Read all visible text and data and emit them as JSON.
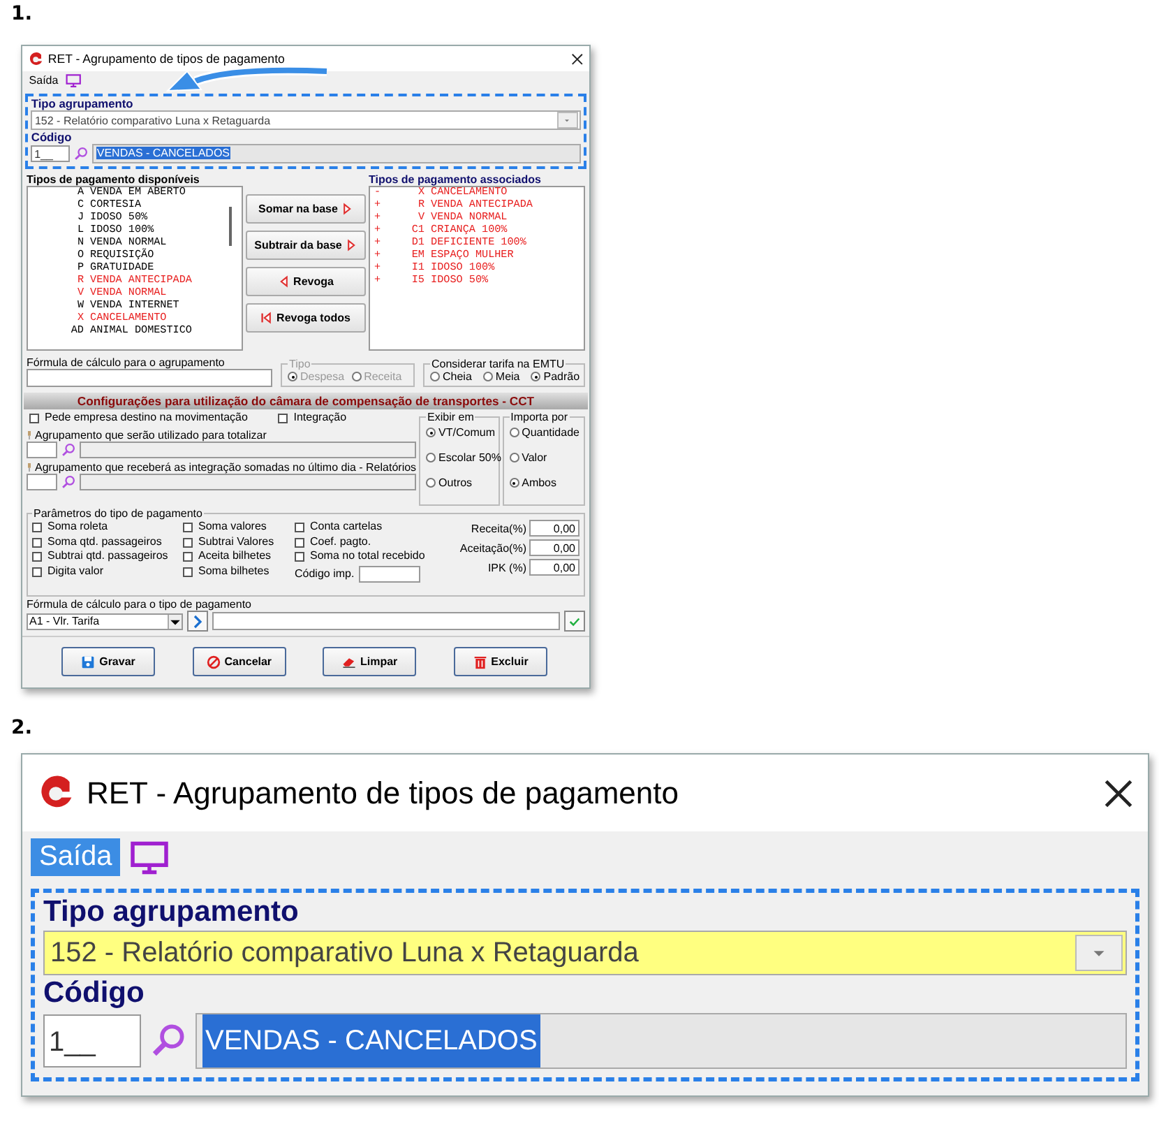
{
  "figure_1": {
    "label": "1.",
    "window": {
      "title": "RET - Agrupamento de tipos de pagamento",
      "menu": [
        {
          "label": "Saída",
          "selected": false
        }
      ],
      "tipo_agrupamento": {
        "label": "Tipo agrupamento",
        "value": "152 - Relatório comparativo Luna x Retaguarda",
        "focused": false
      },
      "codigo": {
        "label": "Código",
        "value": "1__",
        "description": "VENDAS - CANCELADOS"
      },
      "available": {
        "title": "Tipos de pagamento disponíveis",
        "items": [
          {
            "code": "A",
            "name": "VENDA EM ABERTO",
            "highlighted": false
          },
          {
            "code": "C",
            "name": "CORTESIA",
            "highlighted": false
          },
          {
            "code": "J",
            "name": "IDOSO 50%",
            "highlighted": false
          },
          {
            "code": "L",
            "name": "IDOSO 100%",
            "highlighted": false
          },
          {
            "code": "N",
            "name": "VENDA NORMAL",
            "highlighted": false
          },
          {
            "code": "O",
            "name": "REQUISIÇÃO",
            "highlighted": false
          },
          {
            "code": "P",
            "name": "GRATUIDADE",
            "highlighted": false
          },
          {
            "code": "R",
            "name": "VENDA ANTECIPADA",
            "highlighted": true
          },
          {
            "code": "V",
            "name": "VENDA NORMAL",
            "highlighted": true
          },
          {
            "code": "W",
            "name": "VENDA INTERNET",
            "highlighted": false
          },
          {
            "code": "X",
            "name": "CANCELAMENTO",
            "highlighted": true
          },
          {
            "code": "AD",
            "name": "ANIMAL DOMESTICO",
            "highlighted": false
          }
        ]
      },
      "transfer_buttons": [
        {
          "label": "Somar  na base",
          "kind": "add"
        },
        {
          "label": "Subtrair da base",
          "kind": "add"
        },
        {
          "label": "Revoga",
          "kind": "revoke"
        },
        {
          "label": "Revoga todos",
          "kind": "revoke_all"
        }
      ],
      "associated": {
        "title": "Tipos de pagamento associados",
        "items": [
          {
            "sign": "-",
            "code": "X",
            "name": "CANCELAMENTO"
          },
          {
            "sign": "+",
            "code": "R",
            "name": "VENDA ANTECIPADA"
          },
          {
            "sign": "+",
            "code": "V",
            "name": "VENDA NORMAL"
          },
          {
            "sign": "+",
            "code": "C1",
            "name": "CRIANÇA 100%"
          },
          {
            "sign": "+",
            "code": "D1",
            "name": "DEFICIENTE 100%"
          },
          {
            "sign": "+",
            "code": "EM",
            "name": "ESPAÇO MULHER"
          },
          {
            "sign": "+",
            "code": "I1",
            "name": "IDOSO 100%"
          },
          {
            "sign": "+",
            "code": "I5",
            "name": "IDOSO 50%"
          }
        ]
      },
      "formula_agrupamento": {
        "label": "Fórmula de cálculo para o agrupamento"
      },
      "tipo": {
        "label": "Tipo",
        "disabled": true,
        "options": [
          {
            "label": "Despesa",
            "selected": true
          },
          {
            "label": "Receita",
            "selected": false
          }
        ]
      },
      "tarifa": {
        "label": "Considerar tarifa na EMTU",
        "disabled": false,
        "options": [
          {
            "label": "Cheia",
            "selected": false
          },
          {
            "label": "Meia",
            "selected": false
          },
          {
            "label": "Padrão",
            "selected": true
          }
        ]
      },
      "cct_title": "Configurações para utilização do câmara de compensação de transportes - CCT",
      "cct_checks": [
        {
          "label": "Pede empresa destino na movimentação",
          "checked": false
        },
        {
          "label": "Integração",
          "checked": false
        }
      ],
      "cct_fields": [
        {
          "label": "Agrupamento que serão utilizado para totalizar"
        },
        {
          "label": "Agrupamento que receberá as integração somadas no último dia - Relatórios"
        }
      ],
      "exibir_em": {
        "label": "Exibir em",
        "options": [
          {
            "label": "VT/Comum",
            "selected": true
          },
          {
            "label": "Escolar 50%",
            "selected": false
          },
          {
            "label": "Outros",
            "selected": false
          }
        ]
      },
      "importa_por": {
        "label": "Importa por",
        "options": [
          {
            "label": "Quantidade",
            "selected": false
          },
          {
            "label": "Valor",
            "selected": false
          },
          {
            "label": "Ambos",
            "selected": true
          }
        ]
      },
      "parametros": {
        "label": "Parâmetros do tipo de pagamento",
        "columns": [
          [
            {
              "label": "Soma roleta",
              "checked": false
            },
            {
              "label": "Soma qtd. passageiros",
              "checked": false
            },
            {
              "label": "Subtrai qtd. passageiros",
              "checked": false
            },
            {
              "label": "Digita valor",
              "checked": false
            }
          ],
          [
            {
              "label": "Soma valores",
              "checked": false
            },
            {
              "label": "Subtrai Valores",
              "checked": false
            },
            {
              "label": "Aceita bilhetes",
              "checked": false
            },
            {
              "label": "Soma bilhetes",
              "checked": false
            }
          ],
          [
            {
              "label": "Conta cartelas",
              "checked": false
            },
            {
              "label": "Coef. pagto.",
              "checked": false
            },
            {
              "label": "Soma no total recebido",
              "checked": false
            }
          ]
        ],
        "codigo_imp": {
          "label": "Código imp."
        },
        "percent_fields": [
          {
            "label": "Receita(%)",
            "value": "0,00"
          },
          {
            "label": "Aceitação(%)",
            "value": "0,00"
          },
          {
            "label": "IPK (%)",
            "value": "0,00"
          }
        ]
      },
      "formula_tipo": {
        "label": "Fórmula de cálculo para o tipo de pagamento",
        "selection": "A1 - Vlr. Tarifa"
      },
      "buttons": [
        {
          "label": "Gravar",
          "kind": "save"
        },
        {
          "label": "Cancelar",
          "kind": "cancel"
        },
        {
          "label": "Limpar",
          "kind": "clear"
        },
        {
          "label": "Excluir",
          "kind": "delete"
        }
      ]
    }
  },
  "figure_2": {
    "label": "2.",
    "window": {
      "title": "RET - Agrupamento de tipos de pagamento",
      "menu": [
        {
          "label": "Saída",
          "selected": true
        }
      ],
      "tipo_agrupamento": {
        "label": "Tipo agrupamento",
        "value": "152 - Relatório comparativo Luna x Retaguarda",
        "focused": true
      },
      "codigo": {
        "label": "Código",
        "value": "1__",
        "description": "VENDAS - CANCELADOS"
      }
    }
  }
}
